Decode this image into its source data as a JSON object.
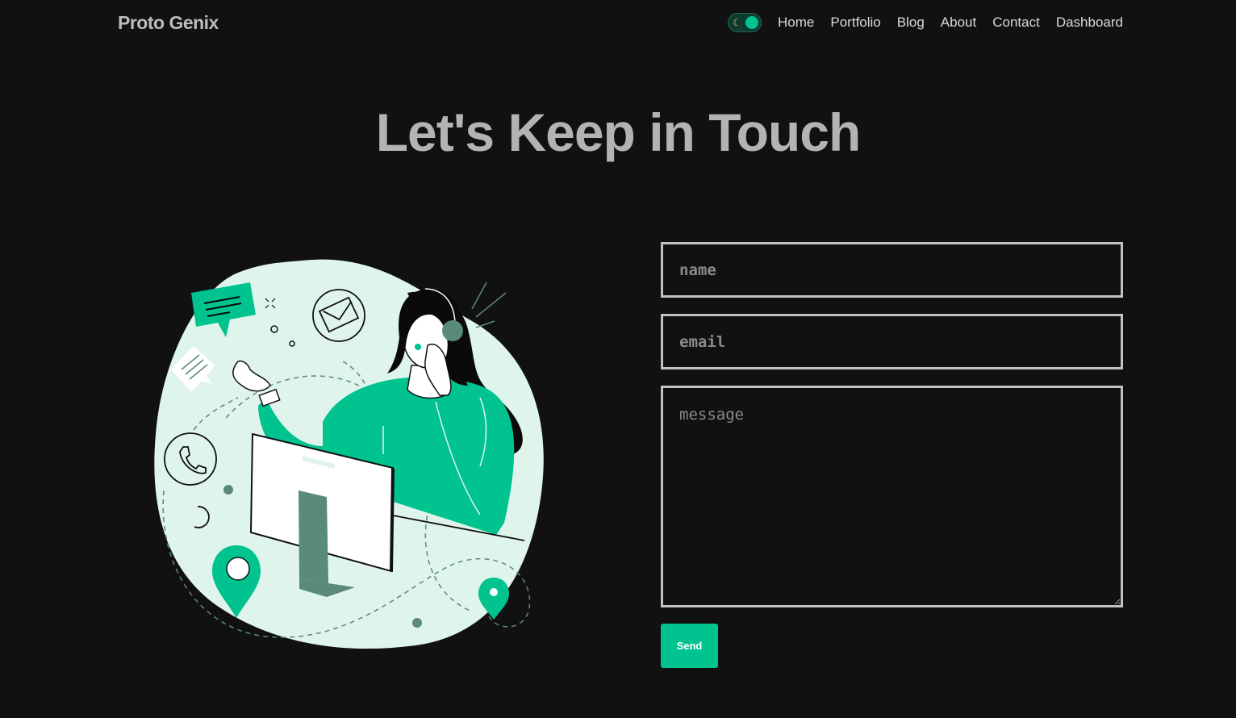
{
  "navbar": {
    "brand": "Proto Genix",
    "theme_toggle_icon": "moon-icon",
    "links": [
      "Home",
      "Portfolio",
      "Blog",
      "About",
      "Contact",
      "Dashboard"
    ]
  },
  "hero": {
    "title": "Let's Keep in Touch"
  },
  "form": {
    "name_placeholder": "name",
    "email_placeholder": "email",
    "message_placeholder": "message",
    "send_label": "Send"
  },
  "colors": {
    "background": "#111111",
    "accent": "#00c38f",
    "accent_dark": "#5a8a78",
    "blob": "#dff5ec"
  }
}
